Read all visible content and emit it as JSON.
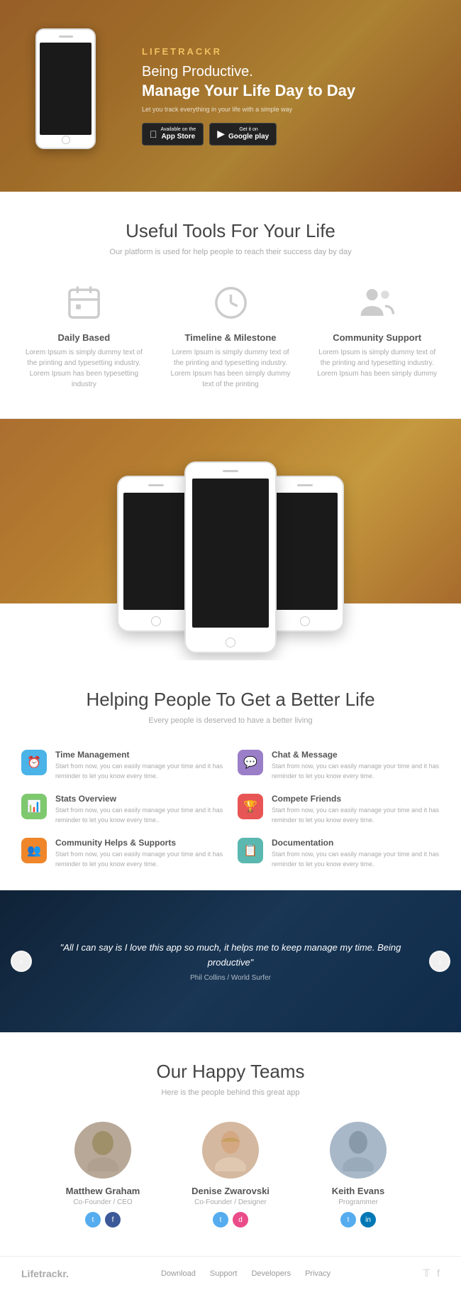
{
  "hero": {
    "brand": "LIFETRACKR",
    "tagline_line1": "Being Productive.",
    "tagline_line2": "Manage Your Life Day to Day",
    "sub": "Let you track everything in your life with a simple way",
    "appstore_label": "Available on the",
    "appstore_name": "App Store",
    "googleplay_label": "Get it on",
    "googleplay_name": "Google play"
  },
  "tools": {
    "section_title": "Useful Tools For Your Life",
    "section_sub": "Our platform is used for help people to reach their success day by day",
    "features": [
      {
        "title": "Daily Based",
        "desc": "Lorem Ipsum is simply dummy text of the printing and typesetting industry. Lorem Ipsum has been typesetting industry"
      },
      {
        "title": "Timeline & Milestone",
        "desc": "Lorem Ipsum is simply dummy text of the printing and typesetting industry. Lorem Ipsum has been simply dummy text of the printing"
      },
      {
        "title": "Community Support",
        "desc": "Lorem Ipsum is simply dummy text of the printing and typesetting industry. Lorem Ipsum has been simply dummy"
      }
    ]
  },
  "better_life": {
    "section_title": "Helping People To Get a Better Life",
    "section_sub": "Every people is deserved to have a better living",
    "features_left": [
      {
        "title": "Time Management",
        "desc": "Start from now, you can easily manage your time and it has reminder to let you know every time.",
        "badge_color": "badge-blue",
        "icon": "⏰"
      },
      {
        "title": "Stats Overview",
        "desc": "Start from now, you can easily manage your time and it has reminder to let you know every time..",
        "badge_color": "badge-green",
        "icon": "📊"
      },
      {
        "title": "Community Helps & Supports",
        "desc": "Start from now, you can easily manage your time and it has reminder to let you know every time.",
        "badge_color": "badge-orange",
        "icon": "👥"
      }
    ],
    "features_right": [
      {
        "title": "Chat & Message",
        "desc": "Start from now, you can easily manage your time and it has reminder to let you know every time.",
        "badge_color": "badge-purple",
        "icon": "💬"
      },
      {
        "title": "Compete Friends",
        "desc": "Start from now, you can easily manage your time and it has reminder to let you know every time.",
        "badge_color": "badge-red",
        "icon": "🏆"
      },
      {
        "title": "Documentation",
        "desc": "Start from now, you can easily manage your time and it has reminder to let you know every time.",
        "badge_color": "badge-teal",
        "icon": "📋"
      }
    ]
  },
  "testimonial": {
    "quote_prefix": "\"All I can say is I love this app so much, it helps me to keep manage my time. Being productive\"",
    "author": "Phil Collins / World Surfer"
  },
  "team": {
    "section_title": "Our Happy Teams",
    "section_sub": "Here is the people behind this great app",
    "members": [
      {
        "name": "Matthew Graham",
        "role": "Co-Founder / CEO",
        "socials": [
          "twitter",
          "facebook"
        ]
      },
      {
        "name": "Denise Zwarovski",
        "role": "Co-Founder / Designer",
        "socials": [
          "twitter",
          "dribbble"
        ]
      },
      {
        "name": "Keith Evans",
        "role": "Programmer",
        "socials": [
          "twitter",
          "linkedin"
        ]
      }
    ]
  },
  "footer": {
    "brand": "Lifetrackr.",
    "nav": [
      "Download",
      "Support",
      "Developers",
      "Privacy"
    ],
    "socials": [
      "twitter",
      "facebook"
    ]
  }
}
